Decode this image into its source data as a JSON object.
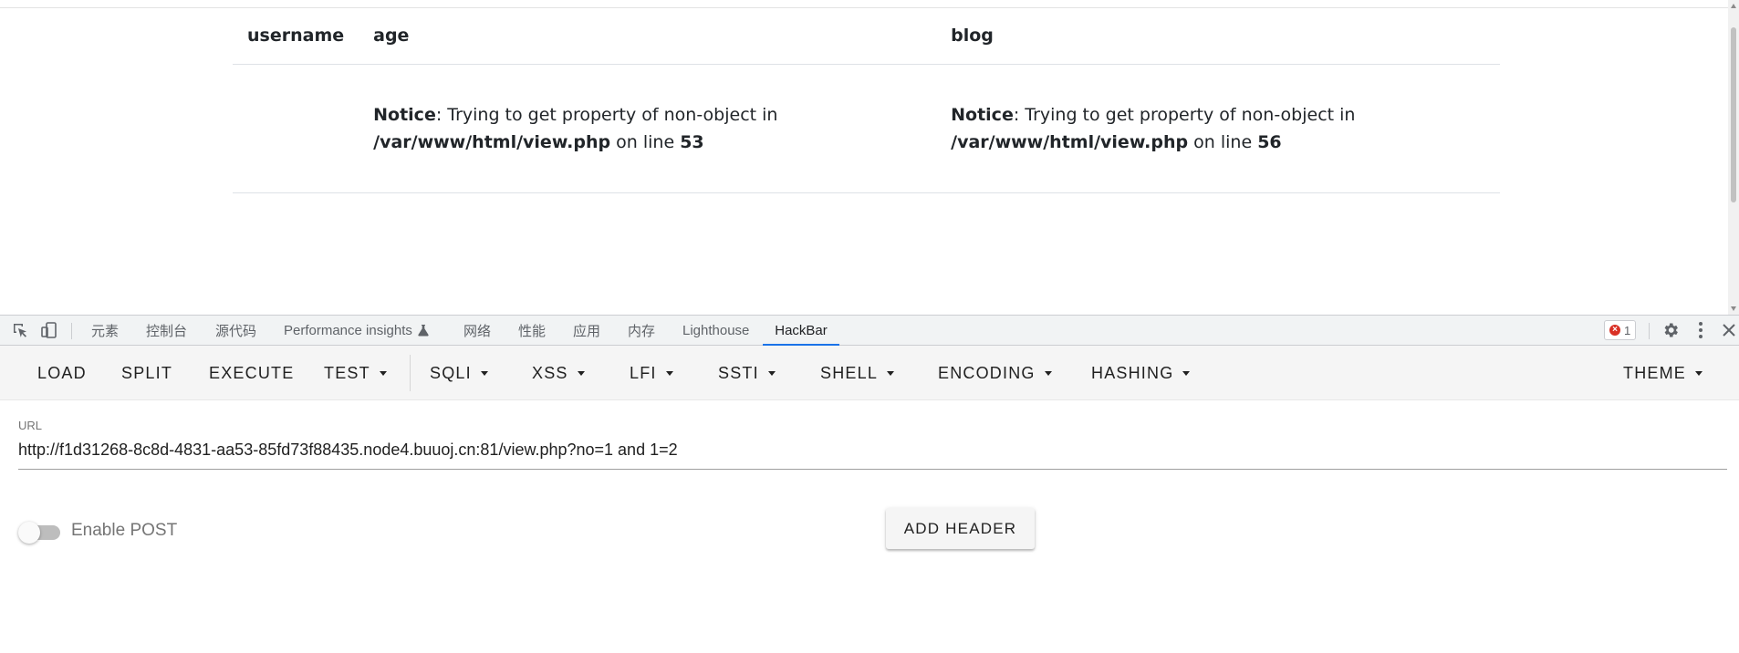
{
  "page": {
    "table": {
      "headers": [
        "username",
        "age",
        "blog"
      ],
      "row": {
        "username": "",
        "age": {
          "notice": "Notice",
          "message": ": Trying to get property of non-object in",
          "path": "/var/www/html/view.php",
          "on_line": "on line",
          "line": "53"
        },
        "blog": {
          "notice": "Notice",
          "message": ": Trying to get property of non-object in",
          "path": "/var/www/html/view.php",
          "on_line": "on line",
          "line": "56"
        }
      }
    }
  },
  "devtools": {
    "tabs": [
      "元素",
      "控制台",
      "源代码",
      "Performance insights",
      "网络",
      "性能",
      "应用",
      "内存",
      "Lighthouse",
      "HackBar"
    ],
    "active_tab": "HackBar",
    "error_count": "1",
    "icons": [
      "inspect-element-icon",
      "device-toolbar-icon",
      "flask-icon",
      "error-icon",
      "gear-icon",
      "more-vert-icon",
      "close-icon"
    ]
  },
  "hackbar": {
    "toolbar": {
      "load": "LOAD",
      "split": "SPLIT",
      "execute": "EXECUTE",
      "test": "TEST",
      "sqli": "SQLI",
      "xss": "XSS",
      "lfi": "LFI",
      "ssti": "SSTI",
      "shell": "SHELL",
      "encoding": "ENCODING",
      "hashing": "HASHING",
      "theme": "THEME"
    },
    "url_label": "URL",
    "url_value": "http://f1d31268-8c8d-4831-aa53-85fd73f88435.node4.buuoj.cn:81/view.php?no=1 and 1=2",
    "enable_post_label": "Enable POST",
    "enable_post": false,
    "add_header_label": "ADD HEADER"
  },
  "colors": {
    "accent": "#1a73e8",
    "error": "#d93025"
  }
}
